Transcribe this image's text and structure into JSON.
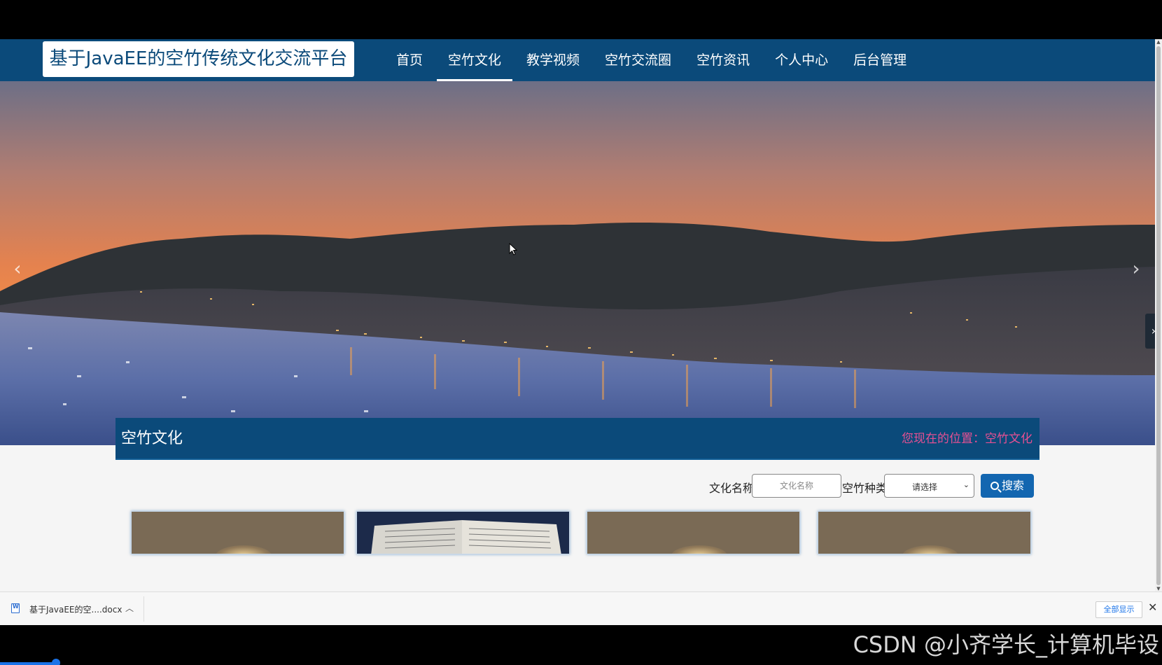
{
  "site": {
    "title": "基于JavaEE的空竹传统文化交流平台"
  },
  "nav": {
    "items": [
      {
        "label": "首页",
        "active": false
      },
      {
        "label": "空竹文化",
        "active": true
      },
      {
        "label": "教学视频",
        "active": false
      },
      {
        "label": "空竹交流圈",
        "active": false
      },
      {
        "label": "空竹资讯",
        "active": false
      },
      {
        "label": "个人中心",
        "active": false
      },
      {
        "label": "后台管理",
        "active": false
      }
    ]
  },
  "banner": {
    "image": "harbor-town-at-dusk",
    "slides": 3,
    "active_slide": 1
  },
  "section": {
    "title": "空竹文化",
    "breadcrumb": "您现在的位置：空竹文化"
  },
  "search": {
    "name_label": "文化名称",
    "name_placeholder": "文化名称",
    "type_label": "空竹种类",
    "type_selected": "请选择",
    "button_label": "搜索"
  },
  "cards": [
    {
      "image": "kongzhu-photo"
    },
    {
      "image": "open-book-photo"
    },
    {
      "image": "kongzhu-photo"
    },
    {
      "image": "kongzhu-photo"
    }
  ],
  "downloads": {
    "file_name": "基于JavaEE的空....docx",
    "show_all": "全部显示",
    "close": "✕"
  },
  "watermark": "CSDN @小齐学长_计算机毕设",
  "colors": {
    "header_bg": "#0b4a7a",
    "breadcrumb": "#e65093",
    "button": "#1366b0"
  }
}
